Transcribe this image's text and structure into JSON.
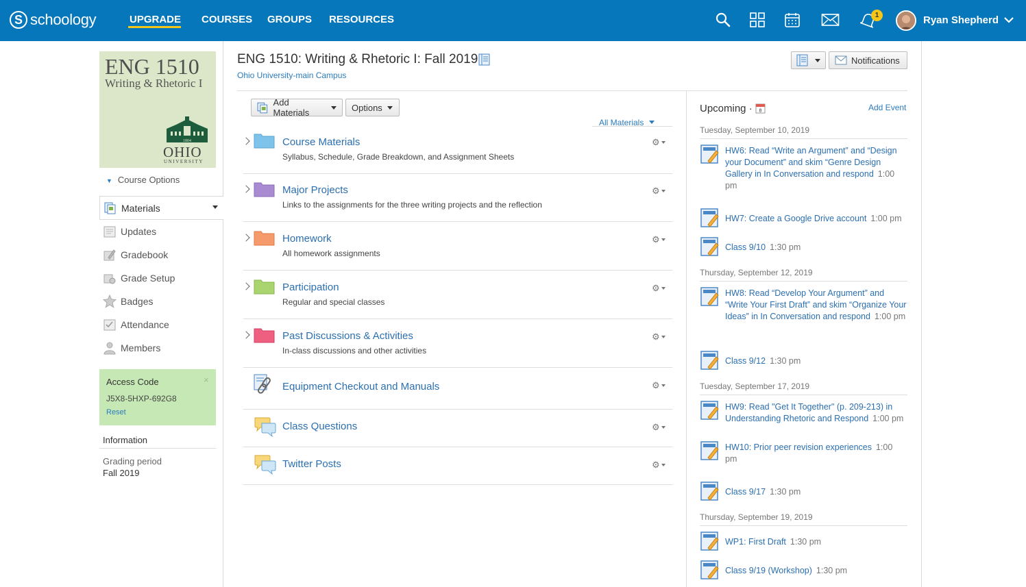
{
  "brand": {
    "logo_letter": "S",
    "logo_text": "schoology"
  },
  "topnav": {
    "items": [
      "UPGRADE",
      "COURSES",
      "GROUPS",
      "RESOURCES"
    ],
    "active": "UPGRADE"
  },
  "topicons": [
    "search-icon",
    "apps-grid-icon",
    "calendar-icon",
    "mail-icon",
    "bell-icon"
  ],
  "notifications_count": "1",
  "user": {
    "name": "Ryan Shepherd"
  },
  "course_picture": {
    "line1": "ENG 1510",
    "line2": "Writing & Rhetoric I",
    "seal_year": "1804",
    "ohio": "OHIO",
    "university": "UNIVERSITY"
  },
  "course_options_label": "Course Options",
  "left_nav": [
    {
      "label": "Materials",
      "icon": "materials-icon",
      "active": true
    },
    {
      "label": "Updates",
      "icon": "updates-icon"
    },
    {
      "label": "Gradebook",
      "icon": "gradebook-icon"
    },
    {
      "label": "Grade Setup",
      "icon": "grade-setup-icon"
    },
    {
      "label": "Badges",
      "icon": "badge-icon"
    },
    {
      "label": "Attendance",
      "icon": "attendance-icon"
    },
    {
      "label": "Members",
      "icon": "members-icon"
    }
  ],
  "access_code": {
    "title": "Access Code",
    "code": "J5X8-5HXP-692G8",
    "reset": "Reset",
    "close": "×"
  },
  "information": {
    "title": "Information",
    "grading_label": "Grading period",
    "grading_value": "Fall 2019"
  },
  "course": {
    "title": "ENG 1510: Writing & Rhetoric I: Fall 2019",
    "campus": "Ohio University-main Campus"
  },
  "header_buttons": {
    "notifications": "Notifications"
  },
  "toolbar": {
    "add_materials": "Add Materials",
    "options": "Options",
    "filter": "All Materials"
  },
  "materials": [
    {
      "title": "Course Materials",
      "desc": "Syllabus, Schedule, Grade Breakdown, and Assignment Sheets",
      "type": "folder",
      "color": "#7ec3ea"
    },
    {
      "title": "Major Projects",
      "desc": "Links to the assignments for the three writing projects and the reflection",
      "type": "folder",
      "color": "#a98bd1"
    },
    {
      "title": "Homework",
      "desc": "All homework assignments",
      "type": "folder",
      "color": "#f59a6a"
    },
    {
      "title": "Participation",
      "desc": "Regular and special classes",
      "type": "folder",
      "color": "#a9d46f"
    },
    {
      "title": "Past Discussions & Activities",
      "desc": "In-class discussions and other activities",
      "type": "folder",
      "color": "#ef5f80"
    },
    {
      "title": "Equipment Checkout and Manuals",
      "desc": "",
      "type": "link"
    },
    {
      "title": "Class Questions",
      "desc": "",
      "type": "discussion"
    },
    {
      "title": "Twitter Posts",
      "desc": "",
      "type": "discussion"
    }
  ],
  "upcoming": {
    "title": "Upcoming",
    "separator": "·",
    "calendar_day": "8",
    "add_event": "Add Event",
    "days": [
      {
        "date": "Tuesday, September 10, 2019",
        "events": [
          {
            "title": "HW6: Read “Write an Argument” and “Design your Document” and skim “Genre Design Gallery in In Conversation and respond",
            "time": "1:00 pm"
          },
          {
            "title": "HW7: Create a Google Drive account",
            "time": "1:00 pm"
          },
          {
            "title": "Class 9/10",
            "time": "1:30 pm"
          }
        ]
      },
      {
        "date": "Thursday, September 12, 2019",
        "events": [
          {
            "title": "HW8: Read “Develop Your Argument” and “Write Your First Draft” and skim “Organize Your Ideas” in In Conversation and respond",
            "time": "1:00 pm"
          },
          {
            "title": "Class 9/12",
            "time": "1:30 pm"
          }
        ]
      },
      {
        "date": "Tuesday, September 17, 2019",
        "events": [
          {
            "title": "HW9: Read \"Get It Together\" (p. 209-213) in Understanding Rhetoric and Respond",
            "time": "1:00 pm"
          },
          {
            "title": "HW10: Prior peer revision experiences",
            "time": "1:00 pm"
          },
          {
            "title": "Class 9/17",
            "time": "1:30 pm"
          }
        ]
      },
      {
        "date": "Thursday, September 19, 2019",
        "events": [
          {
            "title": "WP1: First Draft",
            "time": "1:30 pm"
          },
          {
            "title": "Class 9/19 (Workshop)",
            "time": "1:30 pm"
          }
        ]
      }
    ]
  },
  "colors": {
    "topbar": "#0677ba",
    "accent": "#f5c518",
    "link": "#2b6fb0",
    "access_box": "#c6e8b5"
  }
}
